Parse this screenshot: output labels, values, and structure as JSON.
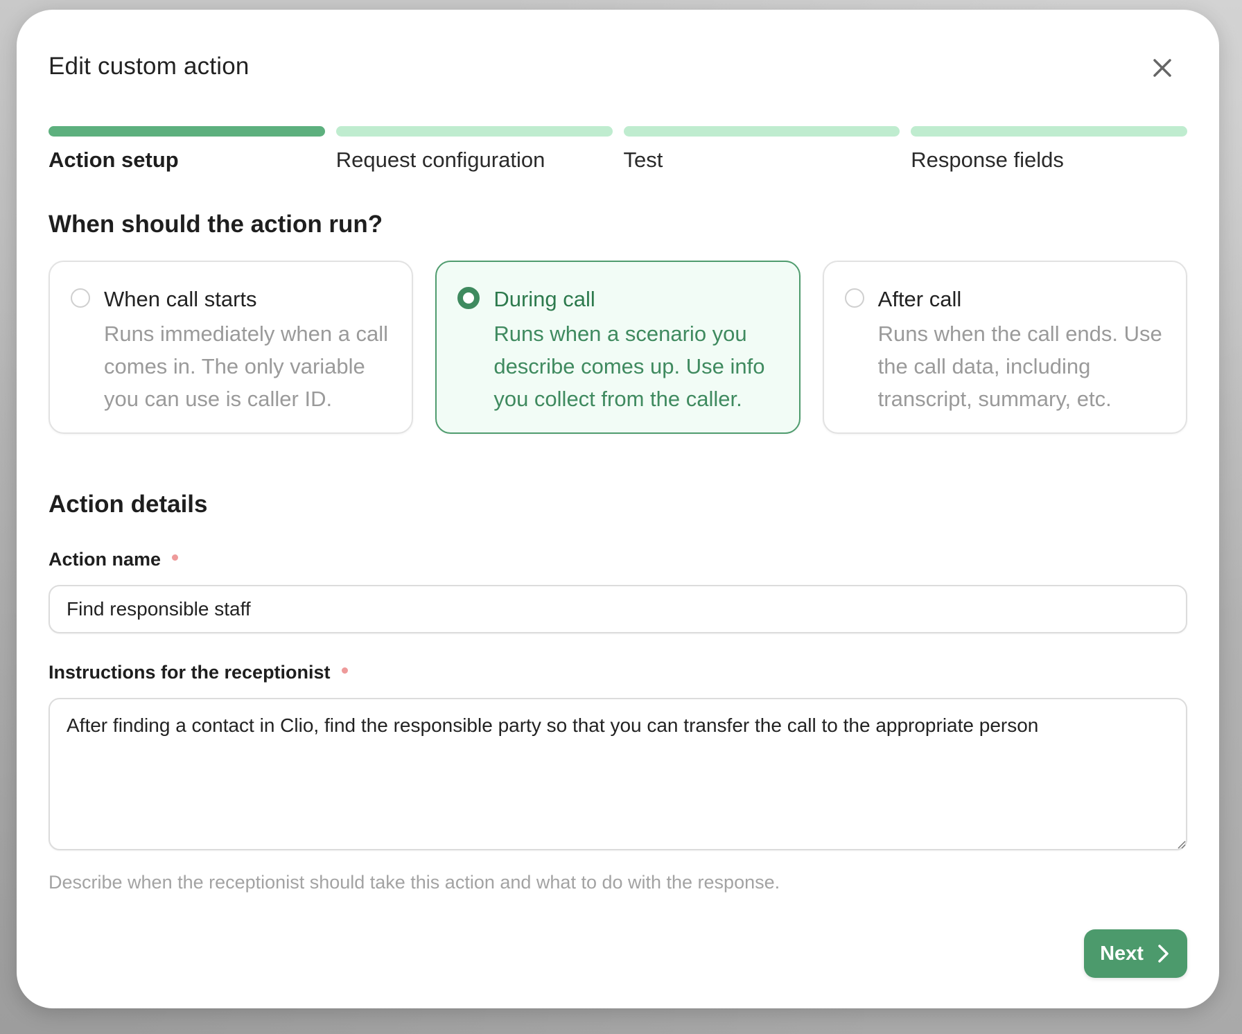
{
  "modal": {
    "title": "Edit custom action",
    "close_icon": "close-icon"
  },
  "steps": [
    {
      "label": "Action setup",
      "active": true
    },
    {
      "label": "Request configuration",
      "active": false
    },
    {
      "label": "Test",
      "active": false
    },
    {
      "label": "Response fields",
      "active": false
    }
  ],
  "when": {
    "heading": "When should the action run?",
    "options": [
      {
        "title": "When call starts",
        "desc": "Runs immediately when a call comes in. The only variable you can use is caller ID.",
        "selected": false
      },
      {
        "title": "During call",
        "desc": "Runs when a scenario you describe comes up. Use info you collect from the caller.",
        "selected": true
      },
      {
        "title": "After call",
        "desc": "Runs when the call ends. Use the call data, including transcript, summary, etc.",
        "selected": false
      }
    ]
  },
  "details": {
    "heading": "Action details",
    "name_label": "Action name",
    "name_value": "Find responsible staff",
    "instructions_label": "Instructions for the receptionist",
    "instructions_value": "After finding a contact in Clio, find the responsible party so that you can transfer the call to the appropriate person",
    "helper_text": "Describe when the receptionist should take this action and what to do with the response."
  },
  "footer": {
    "next_label": "Next",
    "next_icon": "chevron-right-icon"
  },
  "colors": {
    "accent": "#4c9a6c",
    "step_active": "#5db07e",
    "step_inactive": "#bfeccf",
    "selected_bg": "#f2fcf6",
    "required": "#ee9a9a"
  }
}
